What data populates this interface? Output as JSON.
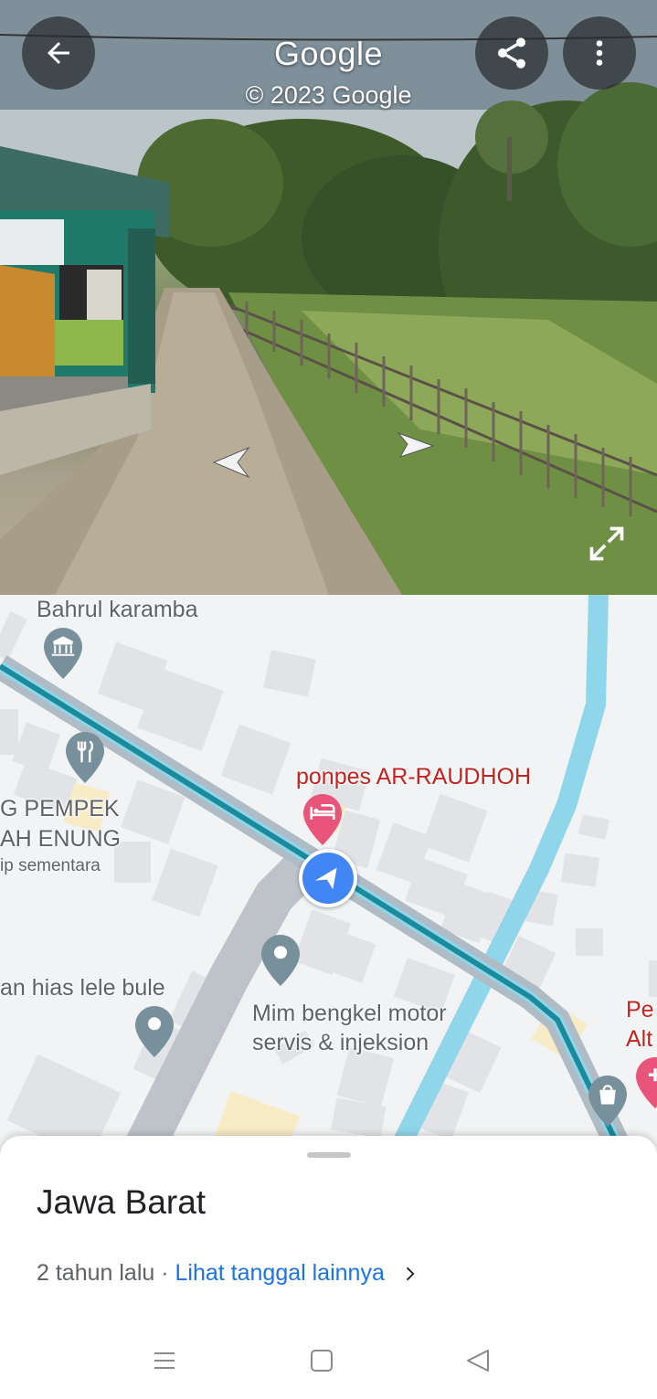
{
  "street_view": {
    "title": "Google",
    "copyright": "© 2023 Google",
    "back_icon": "arrow-left-icon",
    "share_icon": "share-icon",
    "more_icon": "more-vert-icon",
    "expand_icon": "expand-icon"
  },
  "map": {
    "labels": {
      "bahrul": "Bahrul karamba",
      "ponpes": "ponpes AR-RAUDHOH",
      "pempek_line1": "G PEMPEK",
      "pempek_line2": "AH ENUNG",
      "pempek_status": "ip sementara",
      "ikan_hias": "an hias lele bule",
      "bengkel_line1": "Mim bengkel motor",
      "bengkel_line2": "servis & injeksion",
      "right_edge_line1": "Pe",
      "right_edge_line2": "Alt"
    },
    "colors": {
      "route": "#1b8a9a",
      "river": "#8fd6ea",
      "pin_gray": "#78909c",
      "pin_red": "#e8547a",
      "location_blue": "#4285f4"
    }
  },
  "sheet": {
    "place_name": "Jawa Barat",
    "date_text": "2 tahun lalu",
    "separator": " · ",
    "link_text": "Lihat tanggal lainnya",
    "chevron_icon": "chevron-right-icon"
  },
  "system_nav": {
    "recents_icon": "menu-icon",
    "home_icon": "home-square-icon",
    "back_icon": "back-triangle-icon"
  }
}
